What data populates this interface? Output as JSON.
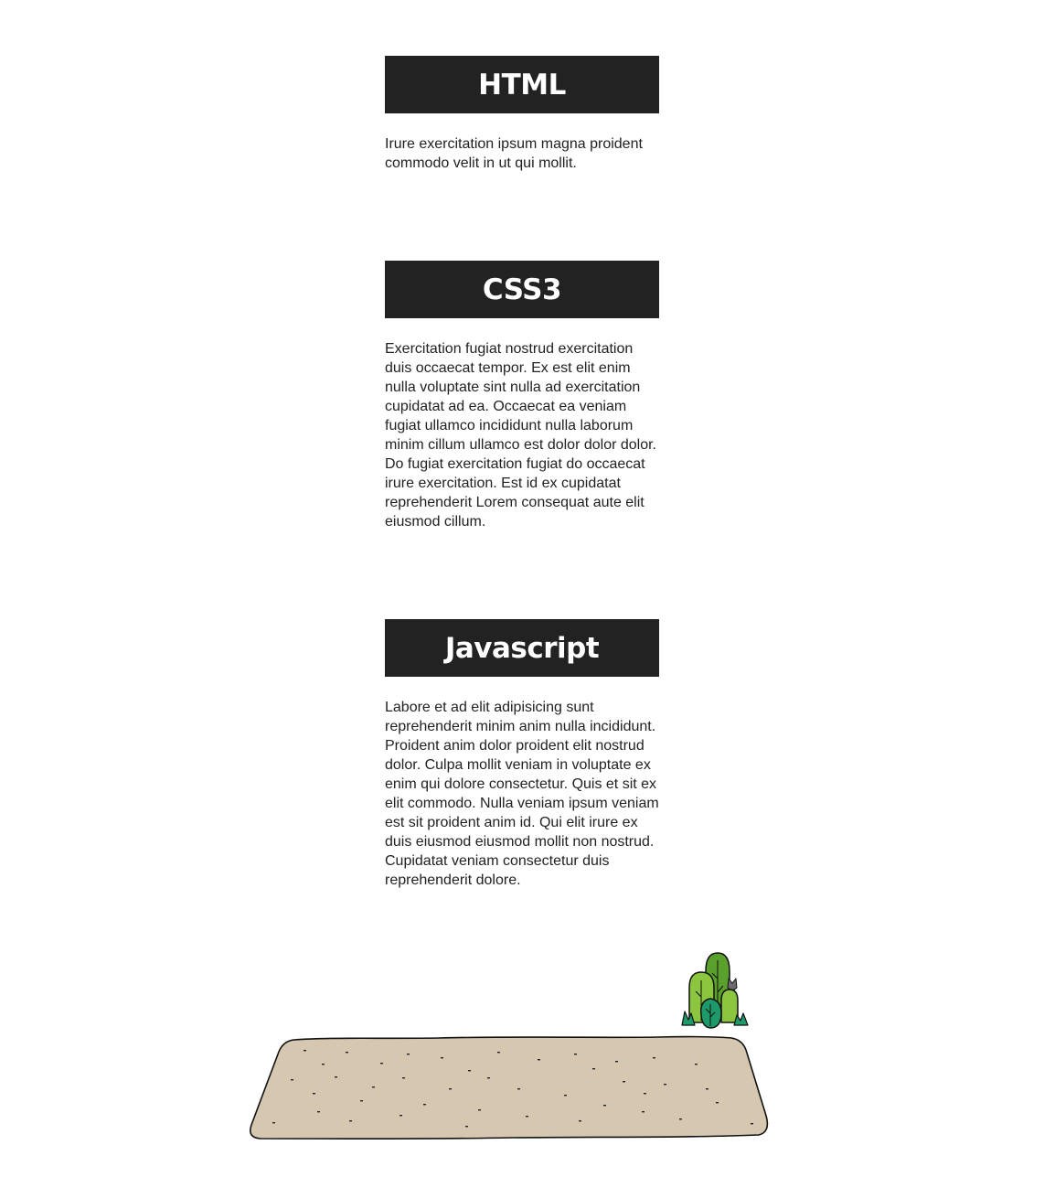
{
  "sections": [
    {
      "title": "HTML",
      "text": "Irure exercitation ipsum magna proident commodo velit in ut qui mollit."
    },
    {
      "title": "CSS3",
      "text": "Exercitation fugiat nostrud exercitation duis occaecat tempor. Ex est elit enim nulla voluptate sint nulla ad exercitation cupidatat ad ea. Occaecat ea veniam fugiat ullamco incididunt nulla laborum minim cillum ullamco est dolor dolor dolor. Do fugiat exercitation fugiat do occaecat irure exercitation. Est id ex cupidatat reprehenderit Lorem consequat aute elit eiusmod cillum."
    },
    {
      "title": "Javascript",
      "text": "Labore et ad elit adipisicing sunt reprehenderit minim anim nulla incididunt. Proident anim dolor proident elit nostrud dolor. Culpa mollit veniam in voluptate ex enim qui dolore consectetur. Quis et sit ex elit commodo. Nulla veniam ipsum veniam est sit proident anim id. Qui elit irure ex duis eiusmod eiusmod mollit non nostrud. Cupidatat veniam consectetur duis reprehenderit dolore."
    }
  ],
  "colors": {
    "heading_bg": "#222222",
    "heading_text": "#ffffff",
    "ground": "#d6c8b0",
    "bush_dark": "#5aa02c",
    "bush_light": "#8cc63f",
    "bush_teal": "#1e9a6a"
  },
  "icons": {
    "ground": "dirt-ground-illustration",
    "bush": "bush-illustration"
  }
}
